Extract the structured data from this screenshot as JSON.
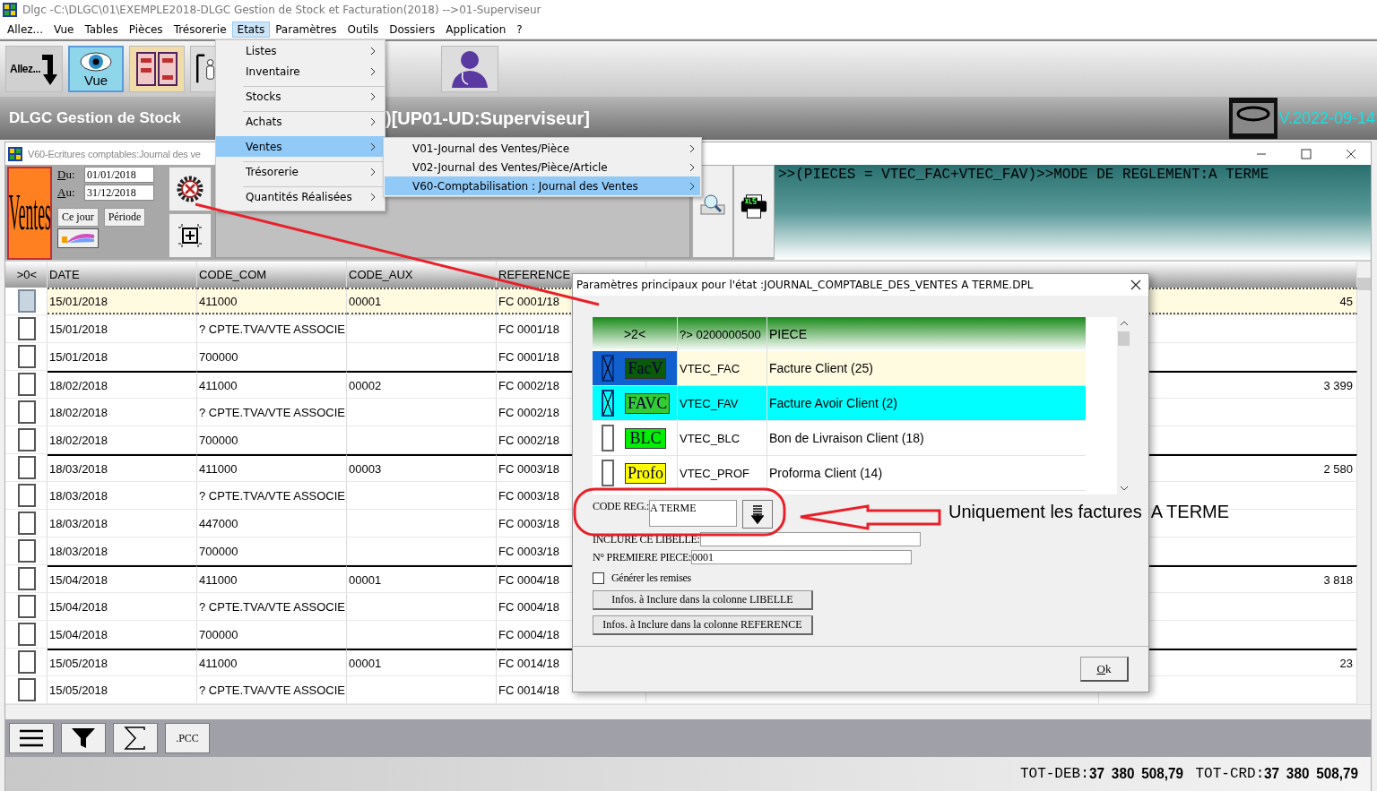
{
  "app_window": {
    "title": "Dlgc -C:\\DLGC\\01\\EXEMPLE2018-DLGC Gestion de Stock et Facturation(2018) -->01-Superviseur"
  },
  "menu_bar": [
    {
      "label": "Allez...",
      "selected": false
    },
    {
      "label": "Vue",
      "selected": false
    },
    {
      "label": "Tables",
      "selected": false
    },
    {
      "label": "Pièces",
      "selected": false
    },
    {
      "label": "Trésorerie",
      "selected": false
    },
    {
      "label": "Etats",
      "selected": true
    },
    {
      "label": "Paramètres",
      "selected": false
    },
    {
      "label": "Outils",
      "selected": false
    },
    {
      "label": "Dossiers",
      "selected": false
    },
    {
      "label": "Application",
      "selected": false
    },
    {
      "label": "?",
      "selected": false
    }
  ],
  "etats_menu": [
    {
      "label": "Listes",
      "selected": false,
      "group_start": false
    },
    {
      "label": "Inventaire",
      "selected": false,
      "group_start": false
    },
    {
      "label": "Stocks",
      "selected": false,
      "group_start": true
    },
    {
      "label": "Achats",
      "selected": false,
      "group_start": true
    },
    {
      "label": "Ventes",
      "selected": true,
      "group_start": true
    },
    {
      "label": "Trésorerie",
      "selected": false,
      "group_start": true
    },
    {
      "label": "Quantités Réalisées",
      "selected": false,
      "group_start": true
    }
  ],
  "ventes_submenu": [
    {
      "label": "V01-Journal des Ventes/Pièce",
      "selected": false
    },
    {
      "label": "V02-Journal des Ventes/Pièce/Article",
      "selected": false
    },
    {
      "label": "V60-Comptabilisation : Journal des Ventes",
      "selected": true
    }
  ],
  "toolbar": [
    {
      "kind": "allez",
      "label": "Allez...",
      "selected": false
    },
    {
      "kind": "vue",
      "label": "Vue",
      "selected": true
    },
    {
      "kind": "shelves",
      "selected": false
    },
    {
      "kind": "person",
      "selected": false
    },
    {
      "kind": "doctor",
      "selected": false
    }
  ],
  "banner": {
    "title": "DLGC Gestion de Stock",
    "title_end": ")[UP01-UD:Superviseur]",
    "version": "V.2022-09-14"
  },
  "journal_window": {
    "title": "V60-Ecritures comptables:Journal des ve",
    "tile": "Ventes",
    "from_label": "Du:",
    "from": "01/01/2018",
    "to_label": "Au:",
    "to": "31/12/2018",
    "buttons": [
      "Ce jour",
      "Période"
    ],
    "filter": ">>(PIECES = VTEC_FAC+VTEC_FAV)>>MODE DE REGLEMENT:A TERME"
  },
  "grid": {
    "select_heading": ">0<",
    "columns": [
      "DATE",
      "CODE_COM",
      "CODE_AUX",
      "REFERENCE"
    ],
    "rows": [
      {
        "date": "15/01/2018",
        "code_com": "411000",
        "code_aux": "00001",
        "reference": "FC 0001/18",
        "debit": "45",
        "group_start": false,
        "selected": true
      },
      {
        "date": "15/01/2018",
        "code_com": "? CPTE.TVA/VTE ASSOCIE",
        "reference": "FC 0001/18",
        "group_start": false,
        "selected": false
      },
      {
        "date": "15/01/2018",
        "code_com": "700000",
        "reference": "FC 0001/18",
        "group_start": false,
        "selected": false
      },
      {
        "date": "18/02/2018",
        "code_com": "411000",
        "code_aux": "00002",
        "reference": "FC 0002/18",
        "debit": "3 399",
        "group_start": true,
        "selected": false
      },
      {
        "date": "18/02/2018",
        "code_com": "? CPTE.TVA/VTE ASSOCIE",
        "reference": "FC 0002/18",
        "group_start": false,
        "selected": false
      },
      {
        "date": "18/02/2018",
        "code_com": "700000",
        "reference": "FC 0002/18",
        "group_start": false,
        "selected": false
      },
      {
        "date": "18/03/2018",
        "code_com": "411000",
        "code_aux": "00003",
        "reference": "FC 0003/18",
        "debit": "2 580",
        "group_start": true,
        "selected": false
      },
      {
        "date": "18/03/2018",
        "code_com": "? CPTE.TVA/VTE ASSOCIE",
        "reference": "FC 0003/18",
        "group_start": false,
        "selected": false
      },
      {
        "date": "18/03/2018",
        "code_com": "447000",
        "reference": "FC 0003/18",
        "group_start": false,
        "selected": false
      },
      {
        "date": "18/03/2018",
        "code_com": "700000",
        "reference": "FC 0003/18",
        "group_start": false,
        "selected": false
      },
      {
        "date": "15/04/2018",
        "code_com": "411000",
        "code_aux": "00001",
        "reference": "FC 0004/18",
        "debit": "3 818",
        "group_start": true,
        "selected": false
      },
      {
        "date": "15/04/2018",
        "code_com": "? CPTE.TVA/VTE ASSOCIE",
        "reference": "FC 0004/18",
        "group_start": false,
        "selected": false
      },
      {
        "date": "15/04/2018",
        "code_com": "700000",
        "reference": "FC 0004/18",
        "group_start": false,
        "selected": false
      },
      {
        "date": "15/05/2018",
        "code_com": "411000",
        "code_aux": "00001",
        "reference": "FC 0014/18",
        "debit": "23",
        "group_start": true,
        "selected": false
      },
      {
        "date": "15/05/2018",
        "code_com": "? CPTE.TVA/VTE ASSOCIE",
        "reference": "FC 0014/18",
        "group_start": false,
        "selected": false
      }
    ]
  },
  "footer": {
    "pcc": ".PCC",
    "deb_label": "TOT-DEB:",
    "deb": "37 380 508,79",
    "crd_label": "TOT-CRD:",
    "crd": "37 380 508,79"
  },
  "dialog": {
    "title": "Paramètres principaux pour l'état :JOURNAL_COMPTABLE_DES_VENTES A TERME.DPL",
    "heading": ">2<",
    "columns": [
      "?> 0200000500",
      "PIECE"
    ],
    "rows": [
      {
        "checked": true,
        "tag": {
          "text": "FacV",
          "color": "#0a5a0a"
        },
        "code": "VTEC_FAC",
        "label": "Facture Client  (25)",
        "selected": true,
        "highlighted": false
      },
      {
        "checked": true,
        "tag": {
          "text": "FAVC",
          "color": "#33cc33"
        },
        "code": "VTEC_FAV",
        "label": "Facture Avoir Client  (2)",
        "selected": false,
        "highlighted": true
      },
      {
        "checked": false,
        "tag": {
          "text": "BLC",
          "color": "#00ee00"
        },
        "code": "VTEC_BLC",
        "label": "Bon de Livraison Client  (18)",
        "selected": false,
        "highlighted": false
      },
      {
        "checked": false,
        "tag": {
          "text": "Profo",
          "color": "#ffff00"
        },
        "code": "VTEC_PROF",
        "label": "Proforma Client  (14)",
        "selected": false,
        "highlighted": false
      }
    ],
    "code_reg_label": "CODE REG.:",
    "code_reg": "A TERME",
    "libelle_label": "INCLURE CE LIBELLE:",
    "piece_label": "N° PREMIERE PIECE:",
    "piece": "0001",
    "remises_label": "Générer les remises",
    "remises_checked": false,
    "buttons": [
      "Infos. à Inclure dans la colonne LIBELLE",
      "Infos. à Inclure dans la colonne REFERENCE"
    ],
    "ok": "Ok"
  },
  "annotation": "Uniquement les factures  A TERME"
}
